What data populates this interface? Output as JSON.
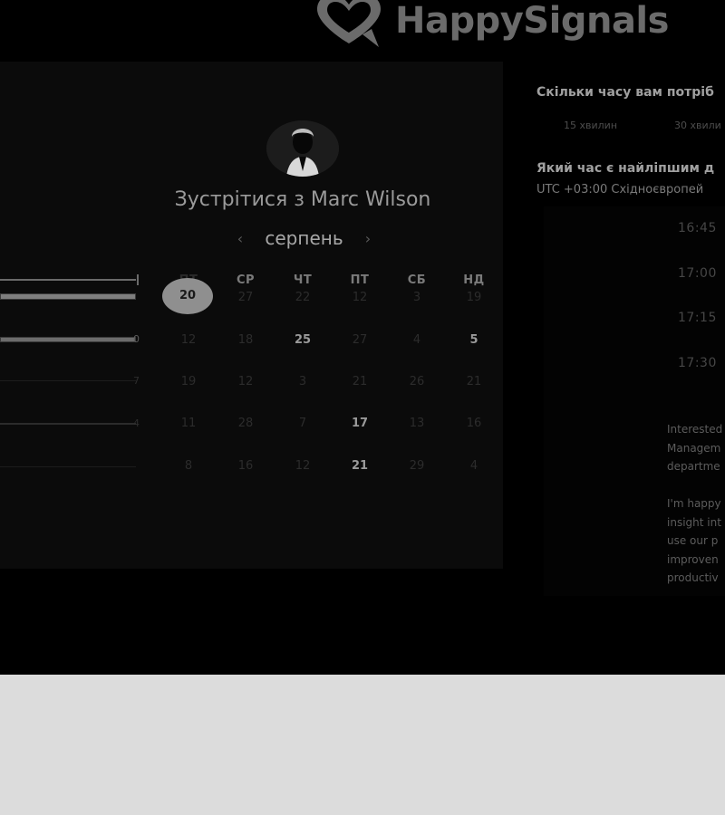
{
  "brand": {
    "name": "HappySignals",
    "logo_icon": "heart-speech-bubble-icon"
  },
  "meeting": {
    "title": "Зустрітися з Marc Wilson"
  },
  "calendar": {
    "month": "серпень",
    "prev_icon": "chevron-left-icon",
    "next_icon": "chevron-right-icon",
    "weekdays": [
      "ПТ",
      "СР",
      "ЧТ",
      "ПТ",
      "СБ",
      "НД"
    ],
    "weeks": [
      [
        "20",
        "27",
        "22",
        "12",
        "3",
        "19"
      ],
      [
        "12",
        "18",
        "25",
        "27",
        "4",
        "5"
      ],
      [
        "19",
        "12",
        "3",
        "21",
        "26",
        "21"
      ],
      [
        "11",
        "28",
        "7",
        "17",
        "13",
        "16"
      ],
      [
        "8",
        "16",
        "12",
        "21",
        "29",
        "4"
      ]
    ],
    "selected_day": "20",
    "available_days": [
      "25",
      "5",
      "17",
      "21"
    ]
  },
  "sliders": [
    {
      "end_label": ""
    },
    {
      "end_label": ""
    },
    {
      "end_label": "0"
    },
    {
      "end_label": "7"
    },
    {
      "end_label": "4"
    },
    {
      "end_label": ""
    }
  ],
  "duration": {
    "question": "Скільки часу вам потріб",
    "options": [
      "15 хвилин",
      "30 хвили"
    ]
  },
  "time": {
    "question": "Який час є найліпшим д",
    "timezone": "UTC +03:00 Східноєвропей",
    "slots": [
      "16:45",
      "17:00",
      "17:15",
      "17:30"
    ]
  },
  "description": {
    "lines": [
      "Interested",
      "Managem",
      "departme",
      "",
      "I'm happy",
      "insight int",
      "use our p",
      "improven",
      "productiv"
    ]
  }
}
